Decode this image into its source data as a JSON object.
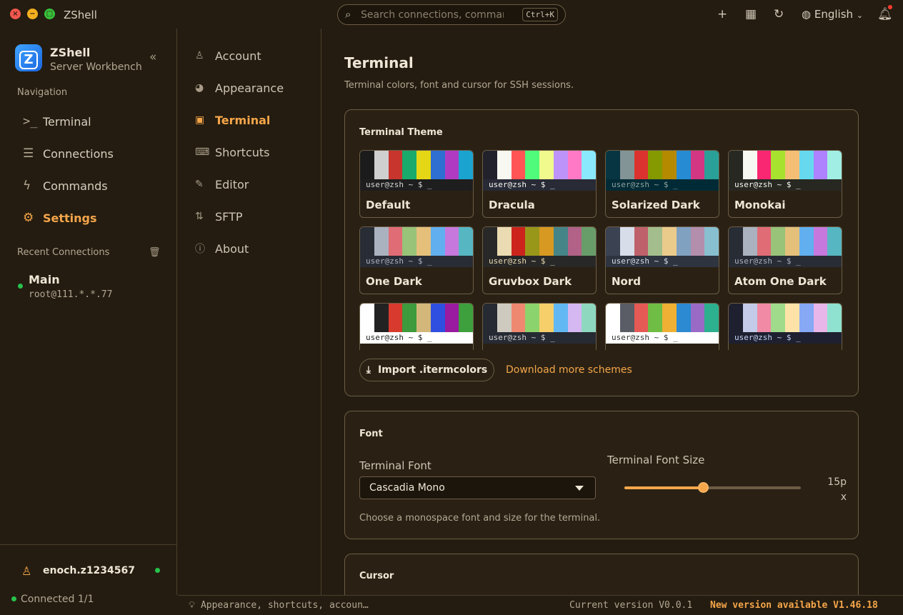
{
  "window": {
    "title": "ZShell"
  },
  "search": {
    "placeholder": "Search connections, comman…",
    "shortcut": "Ctrl+K"
  },
  "topbar": {
    "language": "English"
  },
  "sidebar": {
    "brand_name": "ZShell",
    "brand_subtitle": "Server Workbench",
    "nav_label": "Navigation",
    "items": [
      {
        "label": "Terminal",
        "icon": "terminal-prompt-icon"
      },
      {
        "label": "Connections",
        "icon": "server-stack-icon"
      },
      {
        "label": "Commands",
        "icon": "lightning-icon"
      },
      {
        "label": "Settings",
        "icon": "gear-icon",
        "active": true
      }
    ],
    "recent_label": "Recent Connections",
    "recent": [
      {
        "name": "Main",
        "host": "root@111.*.*.77",
        "status": "online"
      }
    ],
    "user": "enoch.z1234567",
    "connected": "Connected 1/1"
  },
  "settings_nav": {
    "items": [
      {
        "label": "Account",
        "icon": "person-icon"
      },
      {
        "label": "Appearance",
        "icon": "palette-icon"
      },
      {
        "label": "Terminal",
        "icon": "terminal-icon",
        "active": true
      },
      {
        "label": "Shortcuts",
        "icon": "keyboard-icon"
      },
      {
        "label": "Editor",
        "icon": "pencil-icon"
      },
      {
        "label": "SFTP",
        "icon": "transfer-icon"
      },
      {
        "label": "About",
        "icon": "info-icon"
      }
    ]
  },
  "page": {
    "title": "Terminal",
    "subtitle": "Terminal colors, font and cursor for SSH sessions.",
    "theme_card": {
      "title": "Terminal Theme",
      "prompt": "user@zsh ~ $ _",
      "themes": [
        {
          "name": "Default",
          "bg": "#1e1e1e",
          "fg": "#d4d4d4",
          "colors": [
            "#1b1b1b",
            "#cfcfcf",
            "#c8352d",
            "#1aaa6b",
            "#e5d716",
            "#2e6fd1",
            "#b03bc2",
            "#1aa3cf"
          ]
        },
        {
          "name": "Dracula",
          "bg": "#282a36",
          "fg": "#f8f8f2",
          "colors": [
            "#21222c",
            "#f8f8f2",
            "#ff5555",
            "#50fa7b",
            "#f1fa8c",
            "#bd93f9",
            "#ff79c6",
            "#8be9fd"
          ]
        },
        {
          "name": "Solarized Dark",
          "bg": "#002b36",
          "fg": "#93a1a1",
          "colors": [
            "#073642",
            "#839496",
            "#dc322f",
            "#859900",
            "#b58900",
            "#268bd2",
            "#d33682",
            "#2aa198"
          ]
        },
        {
          "name": "Monokai",
          "bg": "#272822",
          "fg": "#f8f8f2",
          "colors": [
            "#272822",
            "#f8f8f2",
            "#f92672",
            "#a6e22e",
            "#f4bf75",
            "#66d9ef",
            "#ae81ff",
            "#a1efe4"
          ]
        },
        {
          "name": "One Dark",
          "bg": "#282c34",
          "fg": "#abb2bf",
          "colors": [
            "#282c34",
            "#abb2bf",
            "#e06c75",
            "#98c379",
            "#e5c07b",
            "#61afef",
            "#c678dd",
            "#56b6c2"
          ]
        },
        {
          "name": "Gruvbox Dark",
          "bg": "#282828",
          "fg": "#ebdbb2",
          "colors": [
            "#282828",
            "#ebdbb2",
            "#cc241d",
            "#98971a",
            "#d79921",
            "#458588",
            "#b16286",
            "#689d6a"
          ]
        },
        {
          "name": "Nord",
          "bg": "#2e3440",
          "fg": "#d8dee9",
          "colors": [
            "#3b4252",
            "#d8dee9",
            "#bf616a",
            "#a3be8c",
            "#ebcb8b",
            "#81a1c1",
            "#b48ead",
            "#88c0d0"
          ]
        },
        {
          "name": "Atom One Dark",
          "bg": "#282c34",
          "fg": "#abb2bf",
          "colors": [
            "#282c34",
            "#abb2bf",
            "#e06c75",
            "#98c379",
            "#e5c07b",
            "#61afef",
            "#c678dd",
            "#56b6c2"
          ]
        },
        {
          "name": "",
          "bg": "#ffffff",
          "fg": "#222222",
          "colors": [
            "#ffffff",
            "#222222",
            "#d83b2d",
            "#3d9a3d",
            "#d3b77a",
            "#2e4fe0",
            "#9a1aa0",
            "#3da03d"
          ]
        },
        {
          "name": "",
          "bg": "#262a33",
          "fg": "#d0d0d0",
          "colors": [
            "#262a33",
            "#cfcac0",
            "#ef8870",
            "#8bd36c",
            "#f6cf6a",
            "#62b8f3",
            "#d5b7f2",
            "#8ed8c0"
          ]
        },
        {
          "name": "",
          "bg": "#ffffff",
          "fg": "#333333",
          "colors": [
            "#ffffff",
            "#5a5d66",
            "#e65a56",
            "#6fbd44",
            "#efb034",
            "#2b8ad2",
            "#9a6bc6",
            "#2cb08e"
          ]
        },
        {
          "name": "",
          "bg": "#1e2030",
          "fg": "#c8d3f5",
          "colors": [
            "#1e2030",
            "#c3cbe8",
            "#f08aa5",
            "#9fdb8a",
            "#fde3a7",
            "#86a8f5",
            "#e8b6e8",
            "#8ee2cf"
          ]
        }
      ],
      "import_label": "Import .itermcolors",
      "download_label": "Download more schemes"
    },
    "font_card": {
      "title": "Font",
      "font_label": "Terminal Font",
      "font_value": "Cascadia Mono",
      "size_label": "Terminal Font Size",
      "size_value": "15px",
      "size_fraction": 0.45,
      "hint": "Choose a monospace font and size for the terminal."
    },
    "cursor_card": {
      "title": "Cursor"
    }
  },
  "statusbar": {
    "tip": "Appearance, shortcuts, accoun…",
    "version": "Current version V0.0.1",
    "update": "New version available V1.46.18"
  },
  "colors": {
    "accent": "#f5a64a",
    "background": "#241c10",
    "online": "#27c24c"
  }
}
